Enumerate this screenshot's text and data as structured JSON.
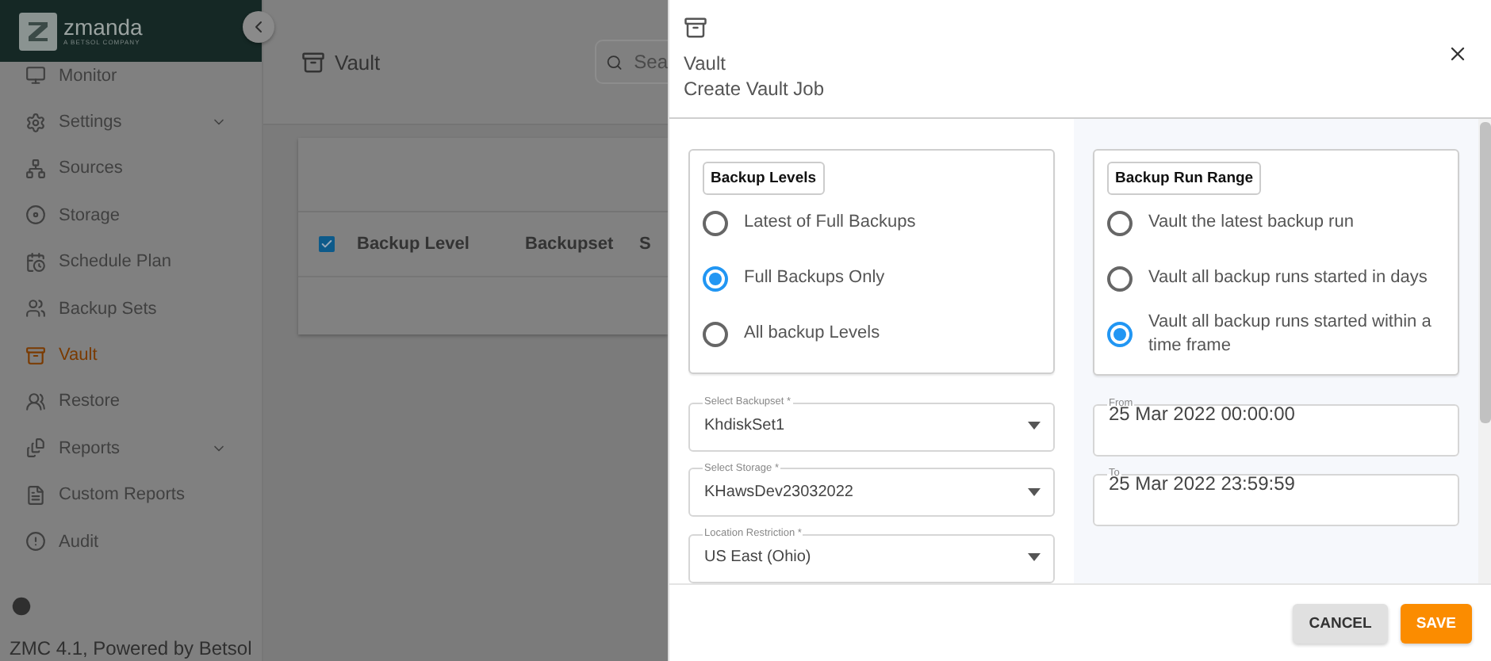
{
  "app": {
    "logo": "zmanda",
    "logo_tagline": "A BETSOL COMPANY",
    "footer": "ZMC 4.1, Powered by Betsol"
  },
  "sidebar": {
    "items": [
      {
        "label": "Monitor",
        "selected": false,
        "has_submenu": false
      },
      {
        "label": "Settings",
        "selected": false,
        "has_submenu": true
      },
      {
        "label": "Sources",
        "selected": false,
        "has_submenu": false
      },
      {
        "label": "Storage",
        "selected": false,
        "has_submenu": false
      },
      {
        "label": "Schedule Plan",
        "selected": false,
        "has_submenu": false
      },
      {
        "label": "Backup Sets",
        "selected": false,
        "has_submenu": false
      },
      {
        "label": "Vault",
        "selected": true,
        "has_submenu": false
      },
      {
        "label": "Restore",
        "selected": false,
        "has_submenu": false
      },
      {
        "label": "Reports",
        "selected": false,
        "has_submenu": true
      },
      {
        "label": "Custom Reports",
        "selected": false,
        "has_submenu": false
      },
      {
        "label": "Audit",
        "selected": false,
        "has_submenu": false
      }
    ]
  },
  "page": {
    "title": "Vault",
    "search": {
      "placeholder": "Sea"
    },
    "table": {
      "select_all": {
        "checked": true
      },
      "columns": [
        "Backup Level",
        "Backupset",
        "S"
      ]
    }
  },
  "drawer": {
    "section": "Vault",
    "title": "Create Vault Job",
    "backup_levels": {
      "title": "Backup Levels",
      "options": [
        {
          "label": "Latest of Full Backups",
          "selected": false
        },
        {
          "label": "Full Backups Only",
          "selected": true
        },
        {
          "label": "All backup Levels",
          "selected": false
        }
      ]
    },
    "selects": [
      {
        "label": "Select Backupset *",
        "value": "KhdiskSet1"
      },
      {
        "label": "Select Storage *",
        "value": "KHawsDev23032022"
      },
      {
        "label": "Location Restriction *",
        "value": "US East (Ohio)"
      }
    ],
    "run_range": {
      "title": "Backup Run Range",
      "options": [
        {
          "label": "Vault the latest backup run",
          "selected": false
        },
        {
          "label": "Vault all backup runs started in days",
          "selected": false
        },
        {
          "label": "Vault all backup runs started within a time frame",
          "selected": true
        }
      ]
    },
    "dates": [
      {
        "label": "From",
        "value": "25 Mar 2022 00:00:00"
      },
      {
        "label": "To",
        "value": "25 Mar 2022 23:59:59"
      }
    ],
    "buttons": [
      {
        "label": "CANCEL",
        "kind": "secondary"
      },
      {
        "label": "SAVE",
        "kind": "primary"
      }
    ]
  }
}
